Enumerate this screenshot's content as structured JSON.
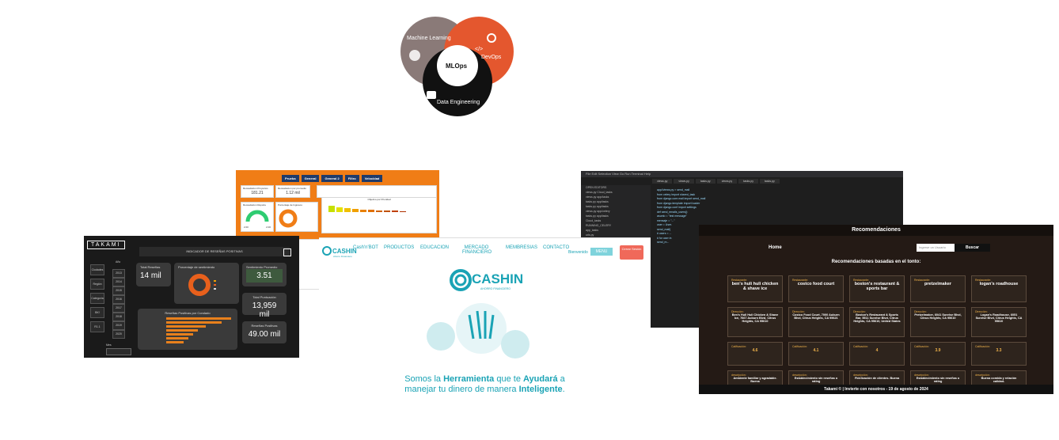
{
  "venn": {
    "ml_label": "Machine Learning",
    "devops_label": "DevOps",
    "center_label": "MLOps",
    "de_label": "Data Engineering",
    "devops_icon": "</>"
  },
  "orange_dashboard": {
    "tabs": [
      "Prueba",
      "General",
      "General 2",
      "Filtro",
      "Velocidad"
    ],
    "card1_title": "Recaudacion Proyectos",
    "card1_value": "181.21",
    "card2_title": "Recaudacion por promedio",
    "card2_value": "1.12 mil",
    "gauge_title": "Recaudacion Reporte",
    "gauge_min": "2.00",
    "gauge_max": "2.00",
    "donut_title": "Porcentaje de Ingresos",
    "bar_title": "Objetivo por Prioridad"
  },
  "takami": {
    "logo": "TAKAMI",
    "title": "INDICADOR DE RESEÑAS POSITIVAS",
    "side_items": [
      "Ciudades",
      "Región",
      "Categoría",
      "BK!",
      "R1.1"
    ],
    "year_header": "Año",
    "years": [
      "2013",
      "2014",
      "2015",
      "2016",
      "2017",
      "2018",
      "2019",
      "2020"
    ],
    "kpi1_label": "Total Reseñas",
    "kpi1_value": "14 mil",
    "donut_title": "Porcentaje de sentimiento",
    "kpi2_label": "Sentimiento Promedio",
    "kpi2_value": "3.51",
    "kpi3_label": "Total Puntuación",
    "kpi3_value": "13,959 mil",
    "kpi4_label": "Reseñas Positivas",
    "kpi4_value": "49.00 mil",
    "bar_title": "Reseñas Positivas por Condado",
    "filter_label": "Mes"
  },
  "editor": {
    "menu": "File  Edit  Selection  View  Go  Run  Terminal  Help",
    "tabs": [
      "views.py",
      "views.py",
      "tasks.py",
      "views.py",
      "tasks.py",
      "tasks.py"
    ],
    "tree_items": [
      "OPEN EDITORS",
      "views.py  Cloud_tasks",
      "views.py  app/tasks",
      "tasks.py  app/tasks",
      "tasks.py  app/tasks",
      "views.py  app/celery",
      "tasks.py  app/tasks",
      "Cloud_tasks",
      "RUNNING_CELERY",
      "app_tasks",
      "urls.py"
    ],
    "code_lines": [
      "app//views.py > send_mail",
      "  from celery import shared_task",
      "  from django.core.mail import send_mail",
      "  from django.template import loader",
      "  from django.conf import settings",
      "",
      "  def send_emails_users():",
      "      asunto = \"test message\"",
      "      mensaje = \"...\"",
      "      user = User.",
      "      send_mail(",
      "        # users = ...",
      "        # for user in",
      "            send_m..."
    ]
  },
  "cashin": {
    "logo_small": "CASHIN",
    "logo_sub": "Ahorro Financiero",
    "nav": [
      "Cash'n'BOT",
      "PRODUCTOS",
      "EDUCACION",
      "MERCADO FINANCIERO",
      "MEMBRESIAS",
      "CONTACTO"
    ],
    "welcome": "Bienvenido",
    "menu_btn": "MENU",
    "logout_btn": "Cerrar Sesión",
    "hero_logo": "CASHIN",
    "hero_sub": "AHORRO FINANCIERO",
    "slogan_a": "Somos la ",
    "slogan_b": "Herramienta",
    "slogan_c": " que te ",
    "slogan_d": "Ayudará",
    "slogan_e": " a",
    "slogan_f": "manejar tu dinero de manera ",
    "slogan_g": "Inteligente",
    "slogan_h": "."
  },
  "recomendaciones": {
    "header": "Recomendaciones",
    "home": "Home",
    "search_placeholder": "Ingrese un Usuario",
    "search_button": "Buscar",
    "subtitle": "Recomendaciones basadas en el tonto:",
    "restaurant_key": "Restaurante:",
    "address_key": "Dirección:",
    "rating_key": "Calificación:",
    "desc_key": "descripción:",
    "items": [
      {
        "name": "ben's huli huli chicken & shave ice",
        "address": "Ben's Huli Huli Chicken & Shave Ice, 7667 Auburn Blvd, Citrus Heights, CA 95610",
        "rating": "4.6",
        "desc": "Ambiente familiar y agradable. Buena"
      },
      {
        "name": "costco food court",
        "address": "Costco Food Court, 7000 Auburn Blvd, Citrus Heights, CA 95621",
        "rating": "4.1",
        "desc": "Establecimiento sin reseñas o rating"
      },
      {
        "name": "boston's restaurant & sports bar",
        "address": "Boston's Restaurant & Sports Bar, 5511 Sunrise Blvd, Citrus Heights, CA 95610, United States",
        "rating": "4",
        "desc": "Fidelización de clientes. Buena"
      },
      {
        "name": "pretzelmaker",
        "address": "Pretzelmaker, 6041 Sunrise Blvd, Citrus Heights, CA 95610",
        "rating": "3.9",
        "desc": "Establecimiento sin reseñas o rating"
      },
      {
        "name": "logan's roadhouse",
        "address": "Logan's Roadhouse, 6051 Sunrise Blvd, Citrus Heights, CA 95610",
        "rating": "3.3",
        "desc": "Buena comida y relación calidad-"
      }
    ],
    "footer": "Takami © | Invierte con nosotros - 19 de agosto de 2024"
  },
  "colors": {
    "orange": "#f07d16",
    "teal": "#1aa3b5",
    "dark": "#1a1a1a",
    "brown": "#241a15",
    "gold": "#f0b34b"
  }
}
